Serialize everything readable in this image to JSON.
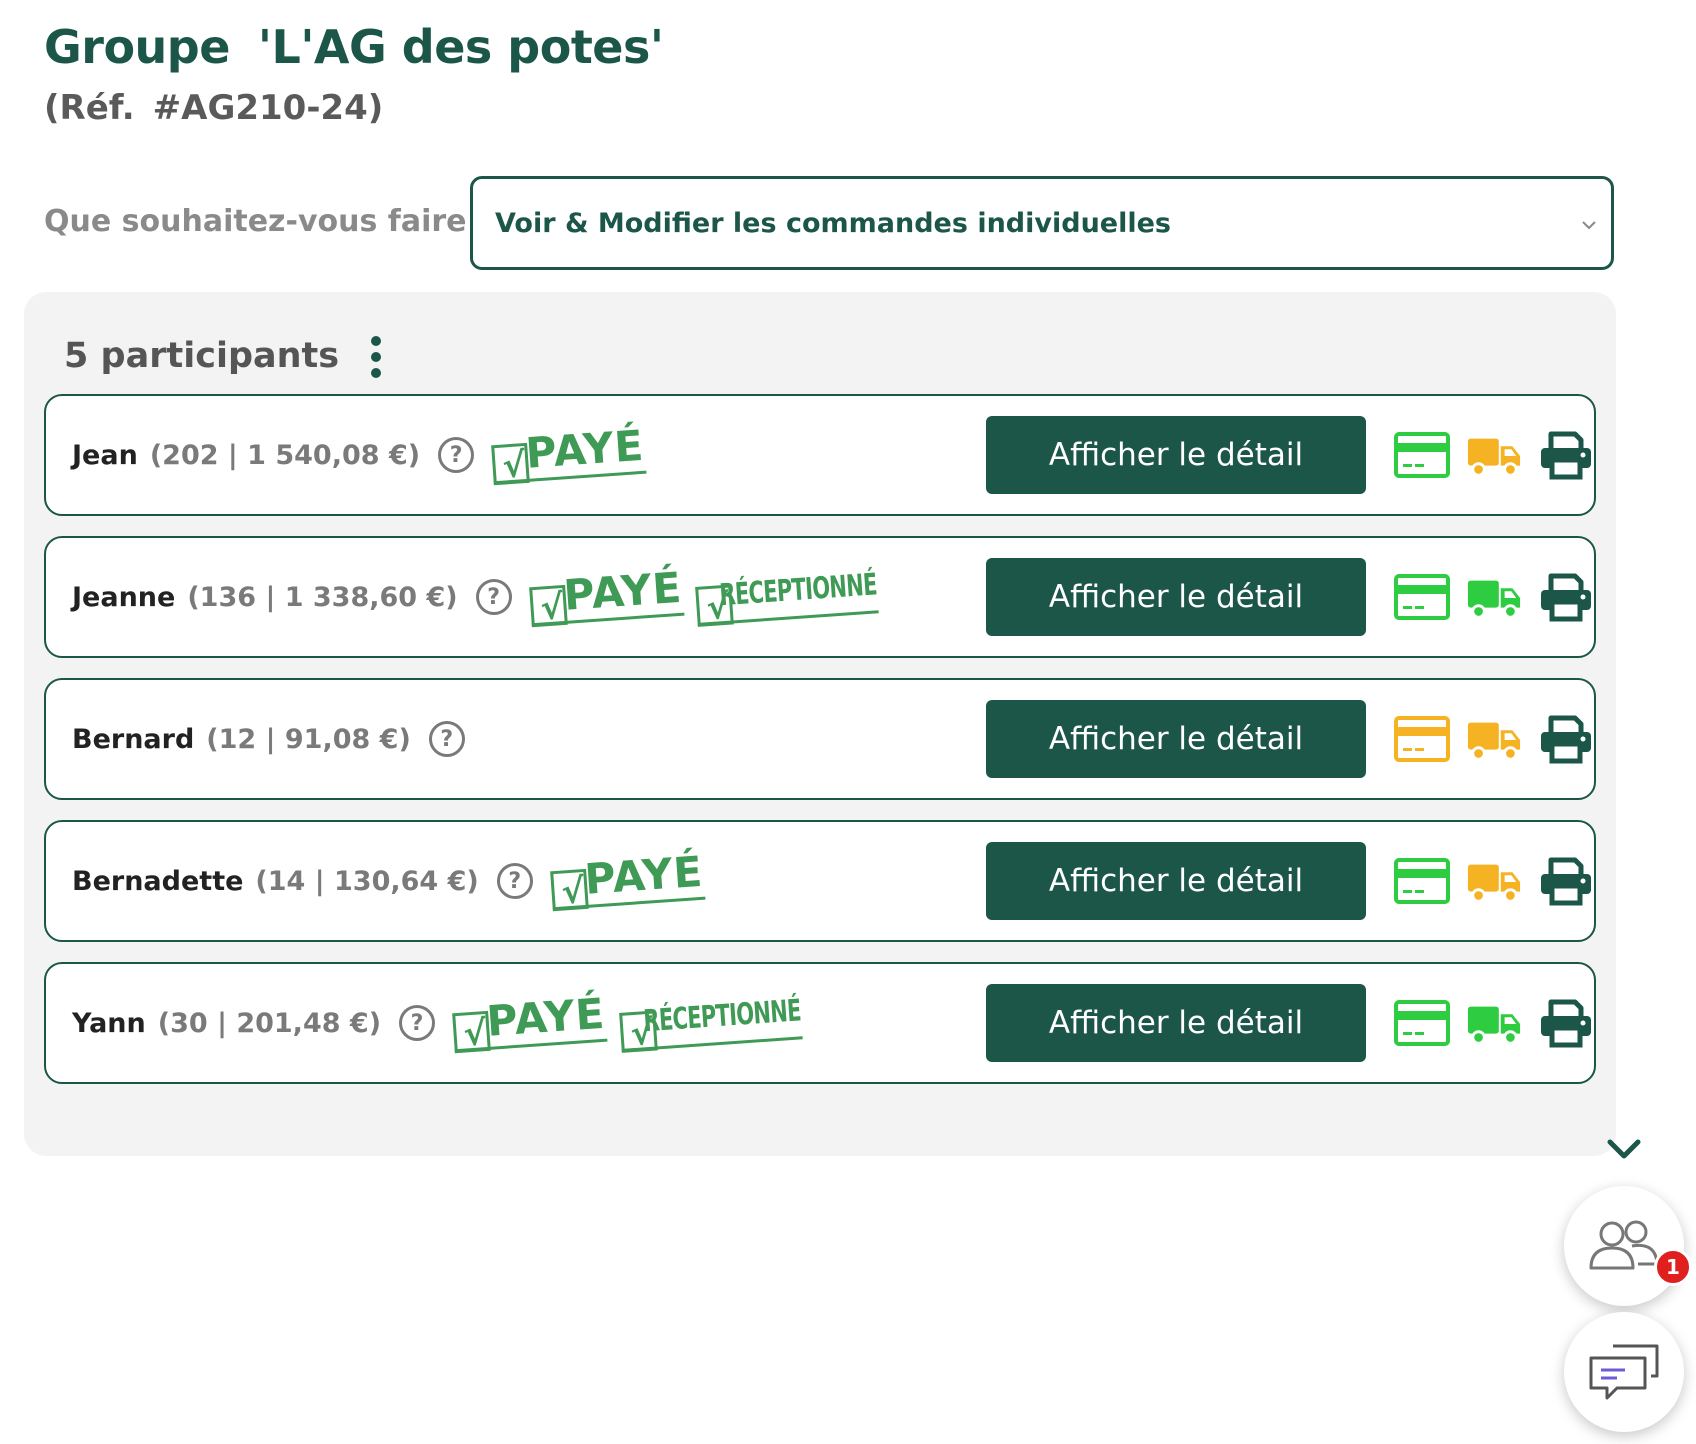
{
  "header": {
    "title_prefix": "Groupe",
    "group_name": "'L'AG des potes'",
    "ref_prefix": "(Réf.",
    "ref_code": "#AG210-24)"
  },
  "action": {
    "label": "Que souhaitez-vous faire ?",
    "selected": "Voir & Modifier les commandes individuelles"
  },
  "panel": {
    "title": "5 participants"
  },
  "stamps": {
    "paid": "PAYÉ",
    "received": "RÉCEPTIONNÉ",
    "check": "√"
  },
  "help_symbol": "?",
  "detail_label": "Afficher le détail",
  "colors": {
    "brand": "#1b5648",
    "stamp": "#3f9a56",
    "status_ok": "#2ecc40",
    "status_pending": "#f5b324",
    "badge": "#e01f1f"
  },
  "participants": [
    {
      "name": "Jean",
      "summary": "(202 | 1 540,08 €)",
      "paid": true,
      "received": false,
      "payment_status": "ok",
      "delivery_status": "pending"
    },
    {
      "name": "Jeanne",
      "summary": "(136 | 1 338,60 €)",
      "paid": true,
      "received": true,
      "payment_status": "ok",
      "delivery_status": "ok"
    },
    {
      "name": "Bernard",
      "summary": "(12 | 91,08 €)",
      "paid": false,
      "received": false,
      "payment_status": "pending",
      "delivery_status": "pending"
    },
    {
      "name": "Bernadette",
      "summary": "(14 | 130,64 €)",
      "paid": true,
      "received": false,
      "payment_status": "ok",
      "delivery_status": "pending"
    },
    {
      "name": "Yann",
      "summary": "(30 | 201,48 €)",
      "paid": true,
      "received": true,
      "payment_status": "ok",
      "delivery_status": "ok"
    }
  ],
  "icons": {
    "payment": "credit-card-icon",
    "delivery": "delivery-truck-icon",
    "print": "printer-icon",
    "participants_fab": "people-icon",
    "chat_fab": "chat-icon"
  },
  "notifications": {
    "participants_badge": "1"
  }
}
